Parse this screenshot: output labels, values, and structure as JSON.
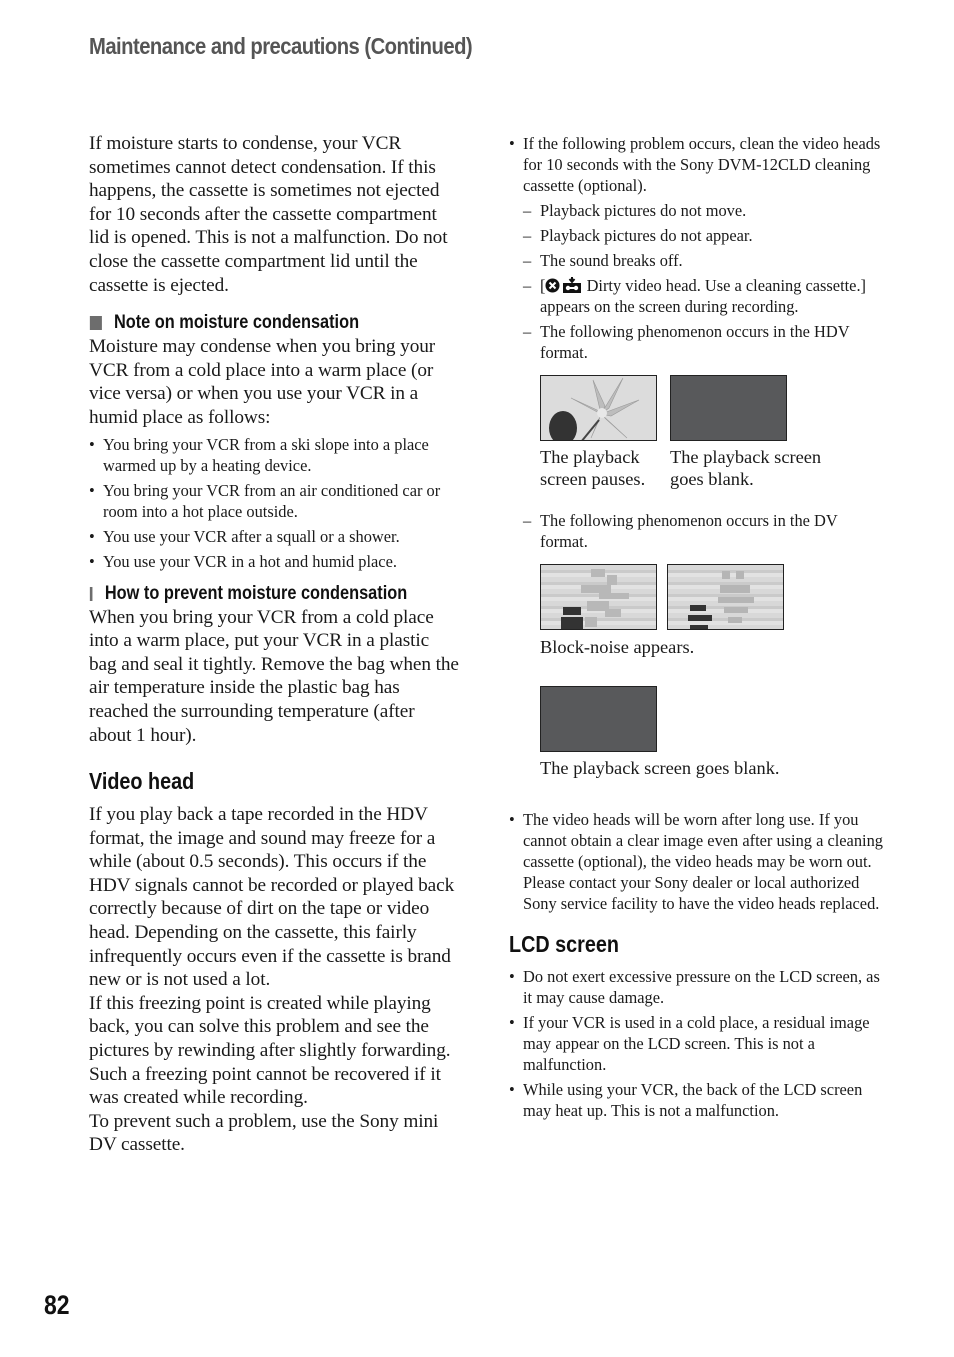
{
  "header": {
    "title": "Maintenance and precautions (Continued)"
  },
  "page_number": "82",
  "left_column": {
    "intro_paragraph": "If moisture starts to condense, your VCR sometimes cannot detect condensation. If this happens, the cassette is sometimes not ejected for 10 seconds after the cassette compartment lid is opened. This is not a malfunction. Do not close the cassette compartment lid until the cassette is ejected.",
    "note_section": {
      "heading": "Note on moisture condensation",
      "paragraph": "Moisture may condense when you bring your VCR from a cold place into a warm place (or vice versa) or when you use your VCR in a humid place as follows:",
      "bullets": [
        "You bring your VCR from a ski slope into a place warmed up by a heating device.",
        "You bring your VCR from an air conditioned car or room into a hot place outside.",
        "You use your VCR after a squall or a shower.",
        "You use your VCR in a hot and humid place."
      ]
    },
    "prevent_section": {
      "heading": "How to prevent moisture condensation",
      "paragraph": "When you bring your VCR from a cold place into a warm place, put your VCR in a plastic bag and seal it tightly. Remove the bag when the air temperature inside the plastic bag has reached the surrounding temperature (after about 1 hour)."
    },
    "video_head_section": {
      "heading": "Video head",
      "paragraphs": [
        "If you play back a tape recorded in the HDV format, the image and sound may freeze for a while (about 0.5 seconds). This occurs if the HDV signals cannot be recorded or played back correctly because of dirt on the tape or video head. Depending on the cassette, this fairly infrequently occurs even if the cassette is brand new or is not used a lot.",
        "If this freezing point is created while playing back, you can solve this problem and see the pictures by rewinding after slightly forwarding. Such a freezing point cannot be recovered if it was created while recording.",
        "To prevent such a problem, use the Sony mini DV cassette."
      ]
    }
  },
  "right_column": {
    "cleaning_bullet": "If the following problem occurs, clean the video heads for 10 seconds with the Sony DVM-12CLD cleaning cassette (optional).",
    "problems": [
      "Playback pictures do not move.",
      "Playback pictures do not appear.",
      "The sound breaks off."
    ],
    "dirty_head_message": {
      "prefix": "[",
      "icons": [
        "warning-x-icon",
        "cassette-head-icon"
      ],
      "text": " Dirty video head. Use a cleaning cassette.] appears on the screen during recording."
    },
    "hdv_item": "The following phenomenon occurs in the HDV format.",
    "hdv_figures": [
      {
        "image": "flower-paused-image",
        "caption": "The playback screen pauses."
      },
      {
        "image": "blank-screen-image",
        "caption": "The playback screen goes blank."
      }
    ],
    "dv_item": "The following phenomenon occurs in the DV format.",
    "dv_figures": [
      {
        "image": "block-noise-image-1"
      },
      {
        "image": "block-noise-image-2"
      }
    ],
    "dv_caption": "Block-noise appears.",
    "dv_blank_caption": "The playback screen goes blank.",
    "worn_heads_bullet": "The video heads will be worn after long use. If you cannot obtain a clear image even after using a cleaning cassette (optional), the video heads may be worn out. Please contact your Sony dealer or local authorized Sony service facility to have the video heads replaced.",
    "lcd_section": {
      "heading": "LCD screen",
      "bullets": [
        "Do not exert excessive pressure on the LCD screen, as it may cause damage.",
        "If your VCR is used in a cold place, a residual image may appear on the LCD screen. This is not a malfunction.",
        "While using your VCR, the back of the LCD screen may heat up. This is not a malfunction."
      ]
    },
    "bullet_mark": "•",
    "dash_mark": "–"
  },
  "colors": {
    "header_gray": "#555555",
    "blank_screen": "#58595b",
    "square_marker": "#6d6d6d"
  }
}
